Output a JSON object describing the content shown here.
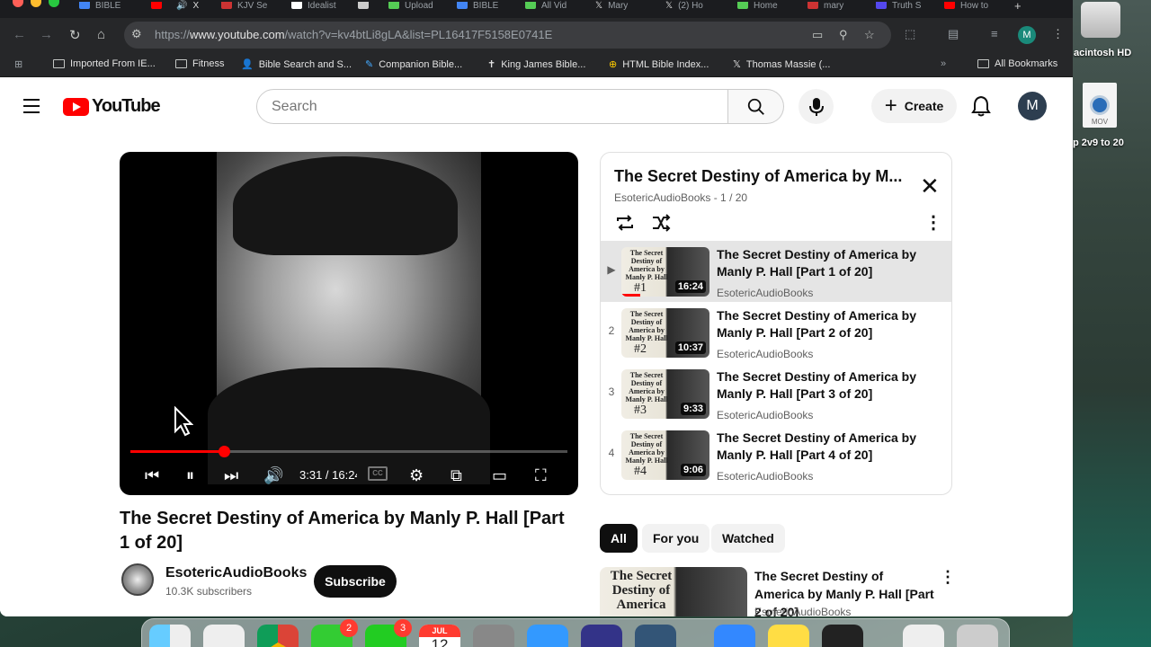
{
  "browser": {
    "tabs": [
      "BIBLE",
      "",
      "X",
      "KJV Se",
      "Idealist",
      "",
      "Upload",
      "BIBLE",
      "All Vid",
      "Mary",
      "(2) Ho",
      "Home",
      "mary",
      "Truth S",
      "How to"
    ],
    "url_prefix": "https://",
    "url_host": "www.youtube.com",
    "url_path": "/watch?v=kv4btLi8gLA&list=PL16417F5158E0741E",
    "profile_initial": "M",
    "bookmarks": [
      "Imported From IE...",
      "Fitness",
      "Bible Search and S...",
      "Companion Bible...",
      "King James Bible...",
      "HTML Bible Index...",
      "Thomas Massie (..."
    ],
    "all_bookmarks": "All Bookmarks",
    "overflow": "»"
  },
  "desktop": {
    "hd_label": "acintosh HD",
    "mov_tag": "MOV",
    "mov_label": "p 2v9 to 20"
  },
  "youtube": {
    "logo_text": "YouTube",
    "search_placeholder": "Search",
    "create_label": "Create",
    "avatar_initial": "M",
    "player": {
      "time": "3:31 / 16:24",
      "progress": 0.215,
      "cc_label": "CC"
    },
    "video": {
      "title": "The Secret Destiny of America by Manly P. Hall [Part 1 of 20]",
      "channel": "EsotericAudioBooks",
      "subscribers": "10.3K subscribers",
      "subscribe_label": "Subscribe"
    },
    "playlist": {
      "title": "The Secret Destiny of America by M...",
      "subtitle": "EsotericAudioBooks - 1 / 20",
      "items": [
        {
          "index": "▶",
          "title": "The Secret Destiny of America by Manly P. Hall [Part 1 of 20]",
          "channel": "EsotericAudioBooks",
          "duration": "16:24",
          "thumb_title": "The Secret Destiny of America by Manly P. Hall",
          "thumb_num": "#1"
        },
        {
          "index": "2",
          "title": "The Secret Destiny of America by Manly P. Hall [Part 2 of 20]",
          "channel": "EsotericAudioBooks",
          "duration": "10:37",
          "thumb_title": "The Secret Destiny of America by Manly P. Hall",
          "thumb_num": "#2"
        },
        {
          "index": "3",
          "title": "The Secret Destiny of America by Manly P. Hall [Part 3 of 20]",
          "channel": "EsotericAudioBooks",
          "duration": "9:33",
          "thumb_title": "The Secret Destiny of America by Manly P. Hall",
          "thumb_num": "#3"
        },
        {
          "index": "4",
          "title": "The Secret Destiny of America by Manly P. Hall [Part 4 of 20]",
          "channel": "EsotericAudioBooks",
          "duration": "9:06",
          "thumb_title": "The Secret Destiny of America by Manly P. Hall",
          "thumb_num": "#4"
        }
      ]
    },
    "chips": [
      "All",
      "For you",
      "Watched"
    ],
    "recommendation": {
      "title": "The Secret Destiny of America by Manly P. Hall [Part 2 of 20]",
      "channel": "EsotericAudioBooks",
      "thumb_title": "The Secret Destiny of America"
    }
  },
  "dock": {
    "badges": {
      "messages": "2",
      "facetime": "3"
    },
    "calendar_month": "JUL",
    "calendar_day": "12"
  },
  "colors": {
    "youtube_red": "#ff0000",
    "browser_chrome": "#262729",
    "accent_dark": "#0f0f0f"
  }
}
